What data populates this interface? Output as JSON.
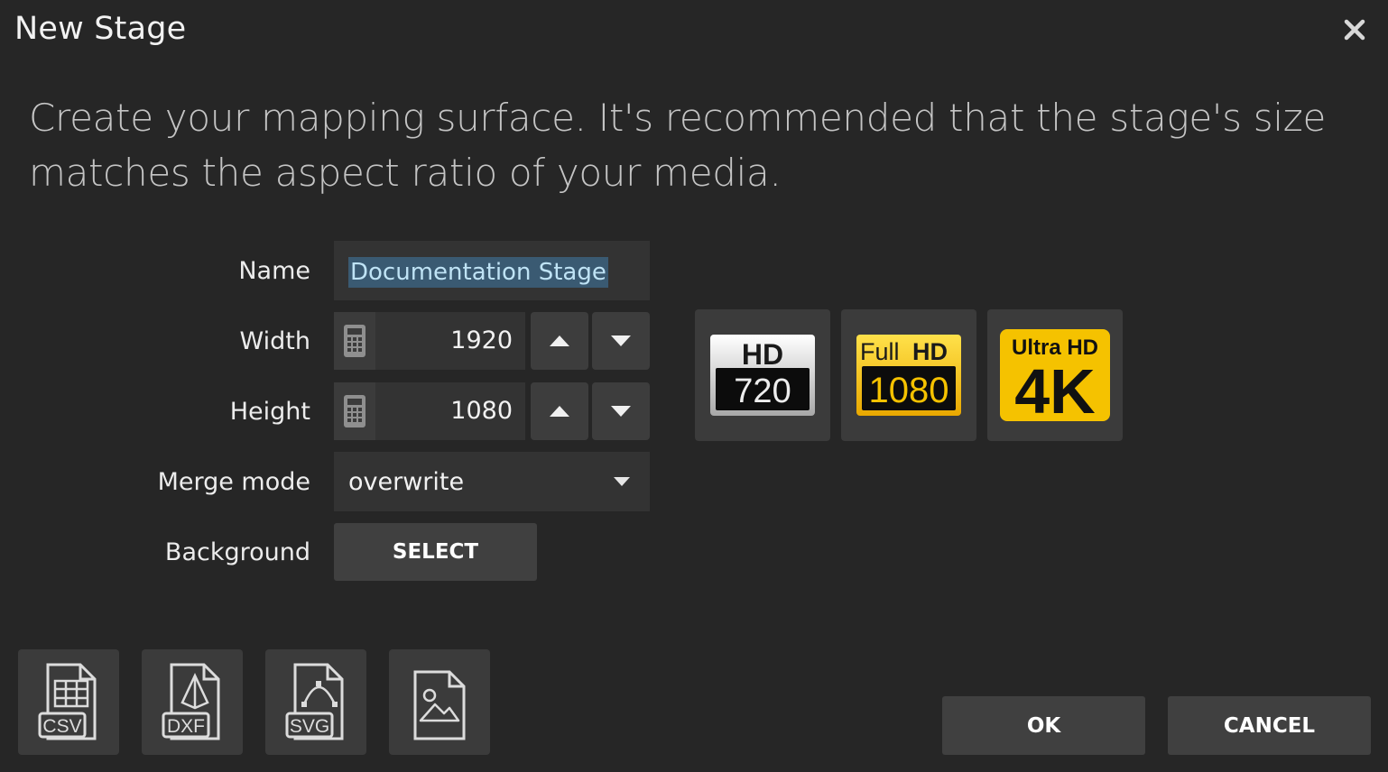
{
  "window": {
    "title": "New Stage",
    "close_icon": "close-icon"
  },
  "description": "Create your mapping surface. It's recommended that the stage's size matches the aspect ratio of your media.",
  "form": {
    "name_label": "Name",
    "name_value": "Documentation Stage",
    "width_label": "Width",
    "width_value": "1920",
    "height_label": "Height",
    "height_value": "1080",
    "merge_label": "Merge mode",
    "merge_value": "overwrite",
    "background_label": "Background",
    "select_label": "SELECT"
  },
  "presets": [
    {
      "line1": "HD",
      "line2": "720",
      "icon": "hd-720-icon"
    },
    {
      "line1": "Full",
      "line1b": "HD",
      "line2": "1080",
      "icon": "full-hd-1080-icon"
    },
    {
      "line1": "Ultra HD",
      "line2": "4K",
      "icon": "ultra-hd-4k-icon"
    }
  ],
  "imports": [
    {
      "tag": "CSV",
      "icon": "csv-file-icon"
    },
    {
      "tag": "DXF",
      "icon": "dxf-file-icon"
    },
    {
      "tag": "SVG",
      "icon": "svg-file-icon"
    },
    {
      "tag": "",
      "icon": "image-file-icon"
    }
  ],
  "footer": {
    "ok_label": "OK",
    "cancel_label": "CANCEL"
  },
  "colors": {
    "background": "#262626",
    "field": "#333333",
    "button": "#404040",
    "selection": "#3a5a72",
    "gold": "#f5c200"
  }
}
